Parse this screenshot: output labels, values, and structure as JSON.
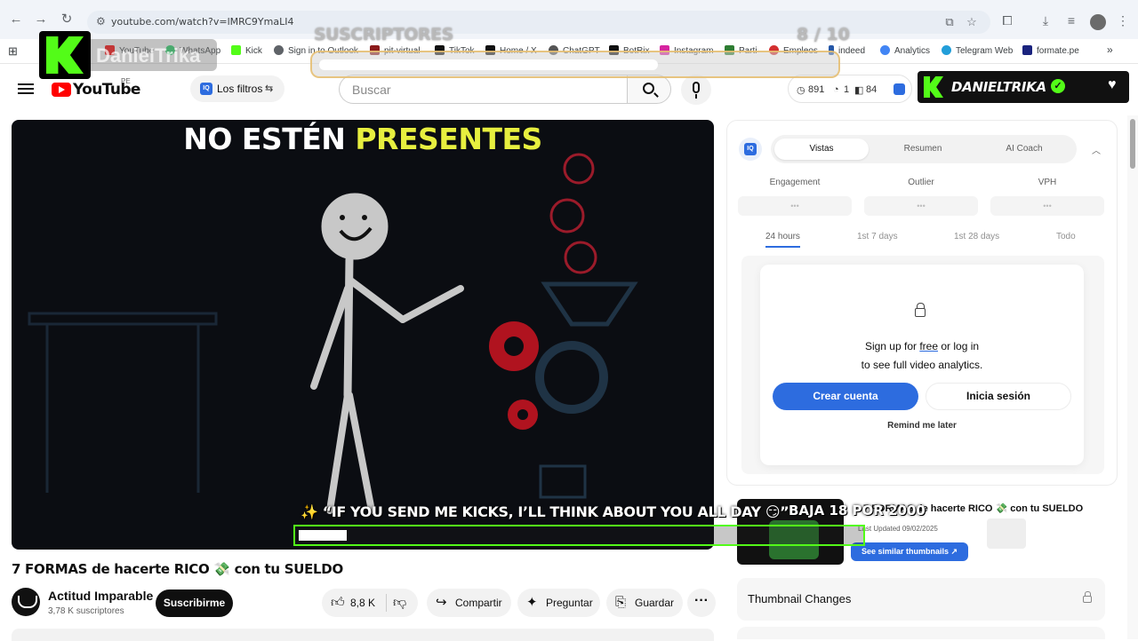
{
  "browser": {
    "url": "youtube.com/watch?v=lMRC9YmaLI4",
    "bookmarks": [
      {
        "label": "YouTube",
        "icon": "youtube-icon",
        "color": "#ff0000"
      },
      {
        "label": "WhatsApp",
        "icon": "whatsapp-icon",
        "color": "#25d366"
      },
      {
        "label": "Kick",
        "icon": "kick-icon",
        "color": "#53fc18"
      },
      {
        "label": "Sign in to Outlook",
        "icon": "globe-icon",
        "color": "#5f6368"
      },
      {
        "label": "pit-virtual",
        "icon": "pit-icon",
        "color": "#8b1a1a"
      },
      {
        "label": "TikTok",
        "icon": "tiktok-icon",
        "color": "#111111"
      },
      {
        "label": "Home / X",
        "icon": "x-icon",
        "color": "#111111"
      },
      {
        "label": "ChatGPT",
        "icon": "chatgpt-icon",
        "color": "#555555"
      },
      {
        "label": "BotRix",
        "icon": "botrix-icon",
        "color": "#111111"
      },
      {
        "label": "Instagram",
        "icon": "instagram-icon",
        "color": "#d6249f"
      },
      {
        "label": "Parti",
        "icon": "parti-icon",
        "color": "#2e7d32"
      },
      {
        "label": "Empleos",
        "icon": "empleos-icon",
        "color": "#d32f2f"
      },
      {
        "label": "indeed",
        "icon": "indeed-icon",
        "color": "#2557a7"
      },
      {
        "label": "Analytics",
        "icon": "analytics-icon",
        "color": "#4285f4"
      },
      {
        "label": "Telegram Web",
        "icon": "telegram-icon",
        "color": "#229ed9"
      },
      {
        "label": "formate.pe",
        "icon": "formate-icon",
        "color": "#1a237e"
      }
    ]
  },
  "overlay": {
    "watermark": "DanielTrika",
    "goal_label": "SUSCRIPTORES",
    "goal_count": "8 / 10",
    "goal_progress": 0.8,
    "streamer_name": "DANIELTRIKA",
    "alert_text": "✨ “IF YOU SEND ME KICKS, I’LL THINK ABOUT YOU ALL DAY 😏”",
    "kick_brand_color": "#53fc18"
  },
  "youtube": {
    "logo_word": "YouTube",
    "country_code": "PE",
    "filters_label": "Los filtros",
    "search_placeholder": "Buscar",
    "stats": {
      "views": "891",
      "likes": "1",
      "comments": "84"
    }
  },
  "video": {
    "overlay_headline_white": "NO ESTÉN",
    "overlay_headline_yellow": "PRESENTES",
    "title": "7 FORMAS de hacerte RICO 💸 con tu SUELDO",
    "channel_name": "Actitud Imparable",
    "channel_subs": "3,78 K suscriptores",
    "subscribe_label": "Suscribirme",
    "like_count": "8,8 K",
    "share_label": "Compartir",
    "ask_label": "Preguntar",
    "save_label": "Guardar"
  },
  "analytics": {
    "tabs": [
      "Vistas",
      "Resumen",
      "AI Coach"
    ],
    "active_tab": "Vistas",
    "metrics": [
      {
        "label": "Engagement",
        "value": "•••"
      },
      {
        "label": "Outlier",
        "value": "•••"
      },
      {
        "label": "VPH",
        "value": "•••"
      }
    ],
    "ranges": [
      "24 hours",
      "1st 7 days",
      "1st 28 days",
      "Todo"
    ],
    "active_range": "24 hours",
    "gate_line1_a": "Sign up for ",
    "gate_line1_free": "free",
    "gate_line1_b": " or log in",
    "gate_line2": "to see full video analytics.",
    "create_account": "Crear cuenta",
    "login": "Inicia sesión",
    "remind_later": "Remind me later",
    "thumb_overlay": "BAJA  18 POR 2000",
    "thumb_title": "7 FORMAS de hacerte RICO 💸 con tu SUELDO",
    "thumb_updated": "Last Updated 09/02/2025",
    "similar_thumbnails": "See similar thumbnails ↗",
    "thumbnail_changes": "Thumbnail Changes",
    "accent_color": "#2d6cdf"
  }
}
